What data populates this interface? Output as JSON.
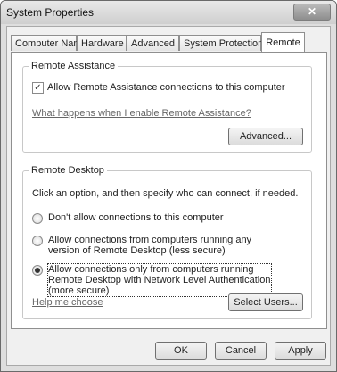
{
  "window": {
    "title": "System Properties",
    "close_glyph": "✕"
  },
  "tabs": [
    {
      "label": "Computer Name"
    },
    {
      "label": "Hardware"
    },
    {
      "label": "Advanced"
    },
    {
      "label": "System Protection"
    },
    {
      "label": "Remote",
      "active": true
    }
  ],
  "remote_assistance": {
    "legend": "Remote Assistance",
    "checkbox_label": "Allow Remote Assistance connections to this computer",
    "checked": true,
    "check_glyph": "✓",
    "help_link": "What happens when I enable Remote Assistance?",
    "advanced_button": "Advanced..."
  },
  "remote_desktop": {
    "legend": "Remote Desktop",
    "instruction": "Click an option, and then specify who can connect, if needed.",
    "options": [
      {
        "label": "Don't allow connections to this computer",
        "selected": false
      },
      {
        "label": "Allow connections from computers running any version of Remote Desktop (less secure)",
        "selected": false
      },
      {
        "label": "Allow connections only from computers running Remote Desktop with Network Level Authentication (more secure)",
        "selected": true
      }
    ],
    "help_link": "Help me choose",
    "select_users_button": "Select Users..."
  },
  "footer": {
    "ok": "OK",
    "cancel": "Cancel",
    "apply": "Apply"
  }
}
